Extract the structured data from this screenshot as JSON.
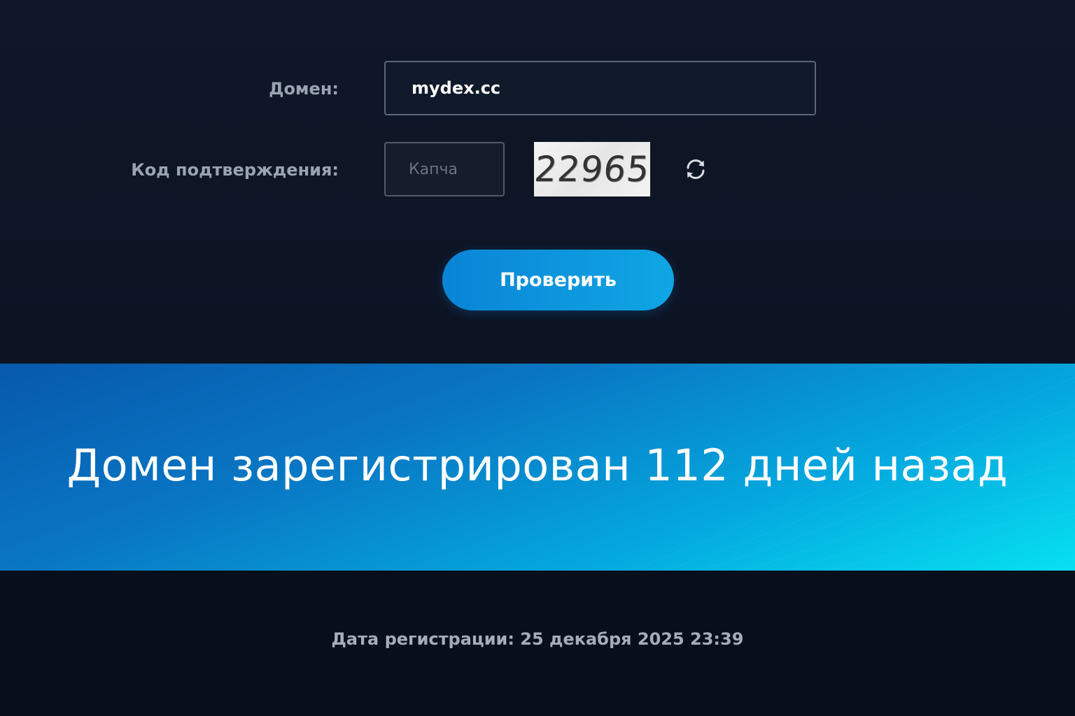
{
  "form": {
    "domain_label": "Домен:",
    "domain_value": "mydex.cc",
    "captcha_label": "Код подтверждения:",
    "captcha_placeholder": "Капча",
    "captcha_code": "22965",
    "refresh_icon": "refresh-icon",
    "submit_label": "Проверить"
  },
  "result": {
    "headline": "Домен зарегистрирован 112 дней назад",
    "date_label": "Дата регистрации:",
    "date_value": "25 декабря 2025 23:39"
  },
  "colors": {
    "background": "#0b1222",
    "button_start": "#0a84d6",
    "button_end": "#0fa6e4",
    "banner_start": "#0759ad",
    "banner_end": "#07e0f1",
    "label_text": "#9aa3b2"
  }
}
